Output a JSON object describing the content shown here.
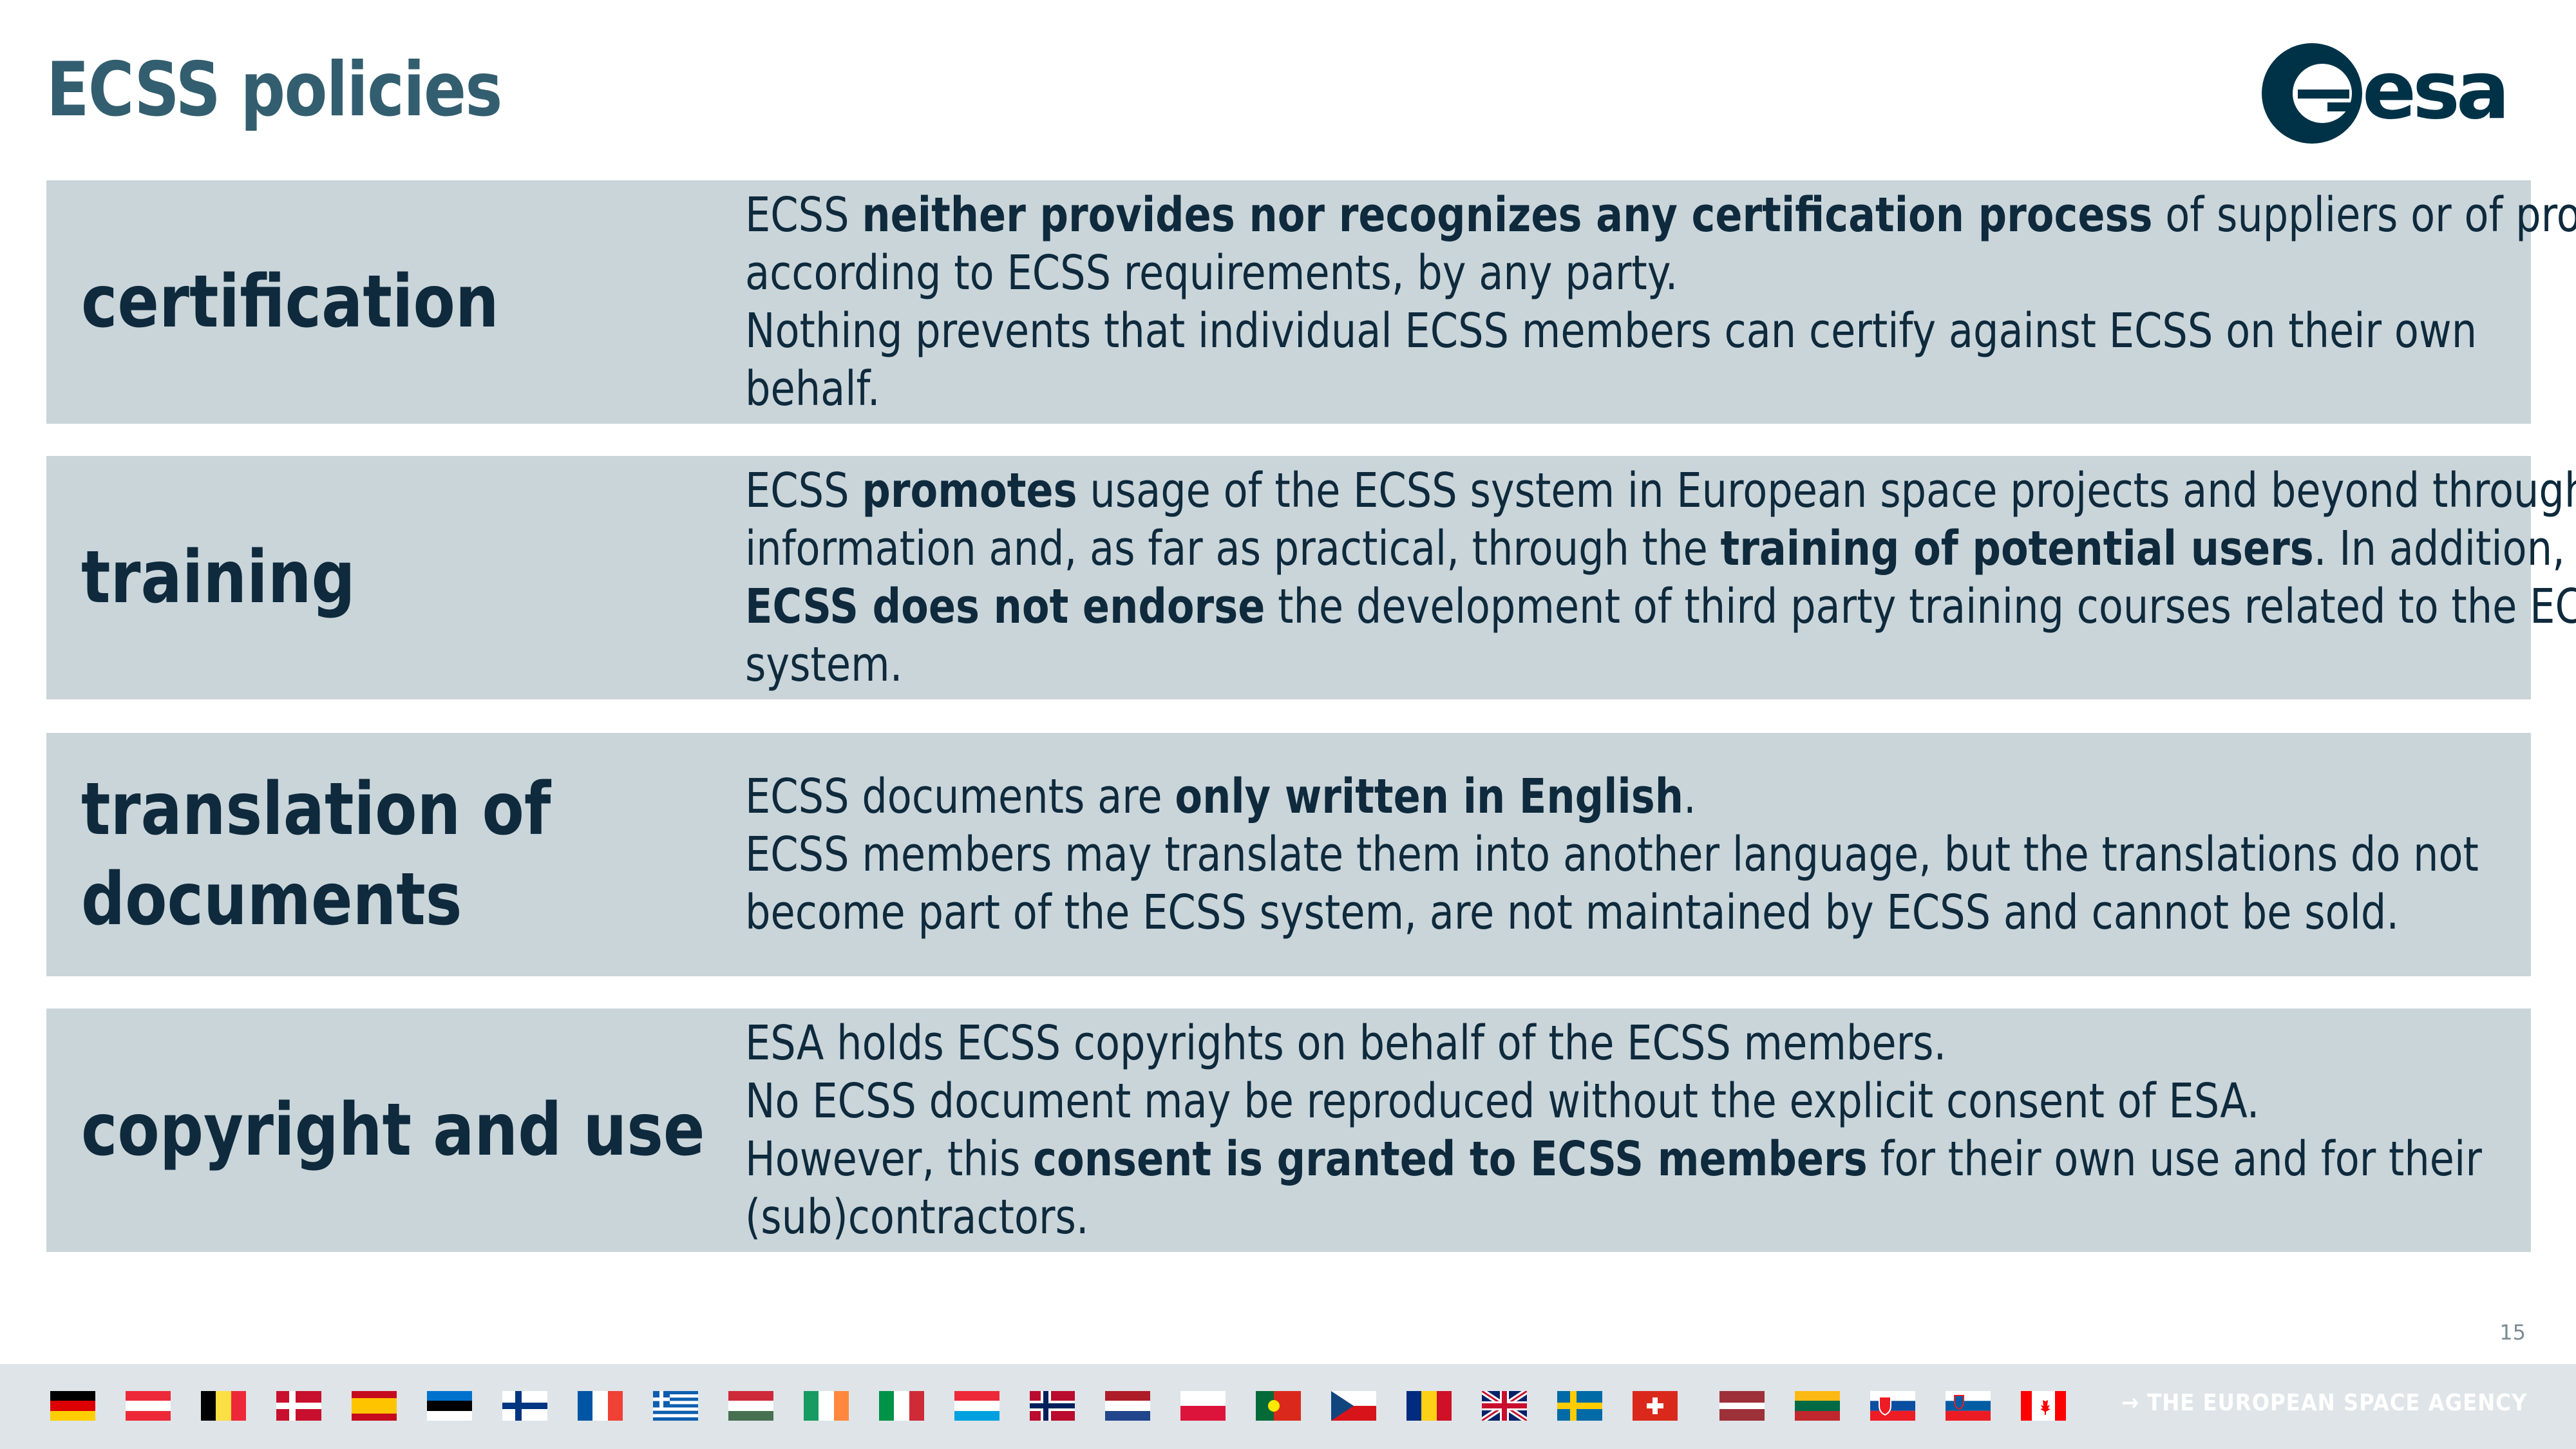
{
  "page": {
    "title": "ECSS policies",
    "page_number": "15"
  },
  "logo": {
    "name": "esa-logo",
    "text": "esa"
  },
  "rows": [
    {
      "label": "certification",
      "lines": [
        [
          {
            "t": "ECSS "
          },
          {
            "t": "neither provides nor recognizes any certification process",
            "b": true
          },
          {
            "t": " of suppliers or of products"
          }
        ],
        [
          {
            "t": "according to ECSS requirements, by any party."
          }
        ],
        [
          {
            "t": "Nothing prevents that individual ECSS members can certify against ECSS on their own"
          }
        ],
        [
          {
            "t": "behalf."
          }
        ]
      ]
    },
    {
      "label": "training",
      "lines": [
        [
          {
            "t": "ECSS "
          },
          {
            "t": "promotes",
            "b": true
          },
          {
            "t": " usage of the ECSS system in European space projects and beyond through"
          }
        ],
        [
          {
            "t": "information and, as far as practical, through the "
          },
          {
            "t": "training of potential users",
            "b": true
          },
          {
            "t": ". In addition,"
          }
        ],
        [
          {
            "t": "ECSS does not endorse",
            "b": true
          },
          {
            "t": " the development of third party training courses related to the ECSS"
          }
        ],
        [
          {
            "t": "system."
          }
        ]
      ]
    },
    {
      "label": "translation of documents",
      "label_lines": [
        "translation of",
        "documents"
      ],
      "lines": [
        [
          {
            "t": "ECSS documents are "
          },
          {
            "t": "only written in English",
            "b": true
          },
          {
            "t": "."
          }
        ],
        [
          {
            "t": "ECSS members may translate them into another language, but the translations do not"
          }
        ],
        [
          {
            "t": "become part of the ECSS system, are not maintained by ECSS and cannot be sold."
          }
        ]
      ]
    },
    {
      "label": "copyright and use",
      "lines": [
        [
          {
            "t": "ESA holds ECSS copyrights on behalf of the ECSS members."
          }
        ],
        [
          {
            "t": "No ECSS document may be reproduced without the explicit consent of ESA."
          }
        ],
        [
          {
            "t": "However, this "
          },
          {
            "t": "consent is granted to ECSS members",
            "b": true
          },
          {
            "t": " for their own use and for their"
          }
        ],
        [
          {
            "t": "(sub)contractors."
          }
        ]
      ]
    }
  ],
  "footer": {
    "tagline": "→ THE EUROPEAN SPACE AGENCY",
    "flags": [
      {
        "name": "germany-flag",
        "dir": "h",
        "colors": [
          "#000000",
          "#dd0000",
          "#ffce00"
        ]
      },
      {
        "name": "austria-flag",
        "dir": "h",
        "colors": [
          "#ed2939",
          "#ffffff",
          "#ed2939"
        ]
      },
      {
        "name": "belgium-flag",
        "dir": "v",
        "colors": [
          "#000000",
          "#fae042",
          "#ed2939"
        ]
      },
      {
        "name": "denmark-flag",
        "special": "nordic",
        "colors": [
          "#c8102e",
          "#ffffff"
        ]
      },
      {
        "name": "spain-flag",
        "special": "spain",
        "colors": [
          "#c60b1e",
          "#ffc400"
        ]
      },
      {
        "name": "estonia-flag",
        "dir": "h",
        "colors": [
          "#0072ce",
          "#000000",
          "#ffffff"
        ]
      },
      {
        "name": "finland-flag",
        "special": "nordic",
        "colors": [
          "#ffffff",
          "#003580"
        ]
      },
      {
        "name": "france-flag",
        "dir": "v",
        "colors": [
          "#0055a4",
          "#ffffff",
          "#ef4135"
        ]
      },
      {
        "name": "greece-flag",
        "special": "greece",
        "colors": [
          "#0d5eaf",
          "#ffffff"
        ]
      },
      {
        "name": "hungary-flag",
        "dir": "h",
        "colors": [
          "#ce2939",
          "#ffffff",
          "#477050"
        ]
      },
      {
        "name": "ireland-flag",
        "dir": "v",
        "colors": [
          "#169b62",
          "#ffffff",
          "#ff883e"
        ]
      },
      {
        "name": "italy-flag",
        "dir": "v",
        "colors": [
          "#009246",
          "#ffffff",
          "#ce2b37"
        ]
      },
      {
        "name": "luxembourg-flag",
        "dir": "h",
        "colors": [
          "#ed2939",
          "#ffffff",
          "#00a1de"
        ]
      },
      {
        "name": "norway-flag",
        "special": "nordic2",
        "colors": [
          "#ba0c2f",
          "#ffffff",
          "#00205b"
        ]
      },
      {
        "name": "netherlands-flag",
        "dir": "h",
        "colors": [
          "#ae1c28",
          "#ffffff",
          "#21468b"
        ]
      },
      {
        "name": "poland-flag",
        "dir": "h",
        "colors": [
          "#ffffff",
          "#dc143c"
        ]
      },
      {
        "name": "portugal-flag",
        "special": "portugal",
        "colors": [
          "#046a38",
          "#da291c",
          "#ffe900"
        ]
      },
      {
        "name": "czech-flag",
        "special": "czech",
        "colors": [
          "#ffffff",
          "#d7141a",
          "#11457e"
        ]
      },
      {
        "name": "romania-flag",
        "dir": "v",
        "colors": [
          "#002b7f",
          "#fcd116",
          "#ce1126"
        ]
      },
      {
        "name": "uk-flag",
        "special": "uk",
        "colors": [
          "#012169",
          "#ffffff",
          "#c8102e"
        ]
      },
      {
        "name": "sweden-flag",
        "special": "nordic",
        "colors": [
          "#006aa7",
          "#fecc00"
        ]
      },
      {
        "name": "switzerland-flag",
        "special": "swiss",
        "colors": [
          "#da291c",
          "#ffffff"
        ]
      },
      {
        "name": "latvia-flag",
        "dir": "h3",
        "colors": [
          "#9e3039",
          "#ffffff",
          "#9e3039"
        ]
      },
      {
        "name": "lithuania-flag",
        "dir": "h",
        "colors": [
          "#fdb913",
          "#006a44",
          "#c1272d"
        ]
      },
      {
        "name": "slovakia-flag",
        "special": "slovakia",
        "colors": [
          "#ffffff",
          "#0b4ea2",
          "#ee1c25"
        ]
      },
      {
        "name": "slovenia-flag",
        "special": "slovenia",
        "colors": [
          "#ffffff",
          "#005da4",
          "#ed1c24"
        ]
      },
      {
        "name": "canada-flag",
        "special": "canada",
        "colors": [
          "#ff0000",
          "#ffffff"
        ]
      }
    ]
  }
}
